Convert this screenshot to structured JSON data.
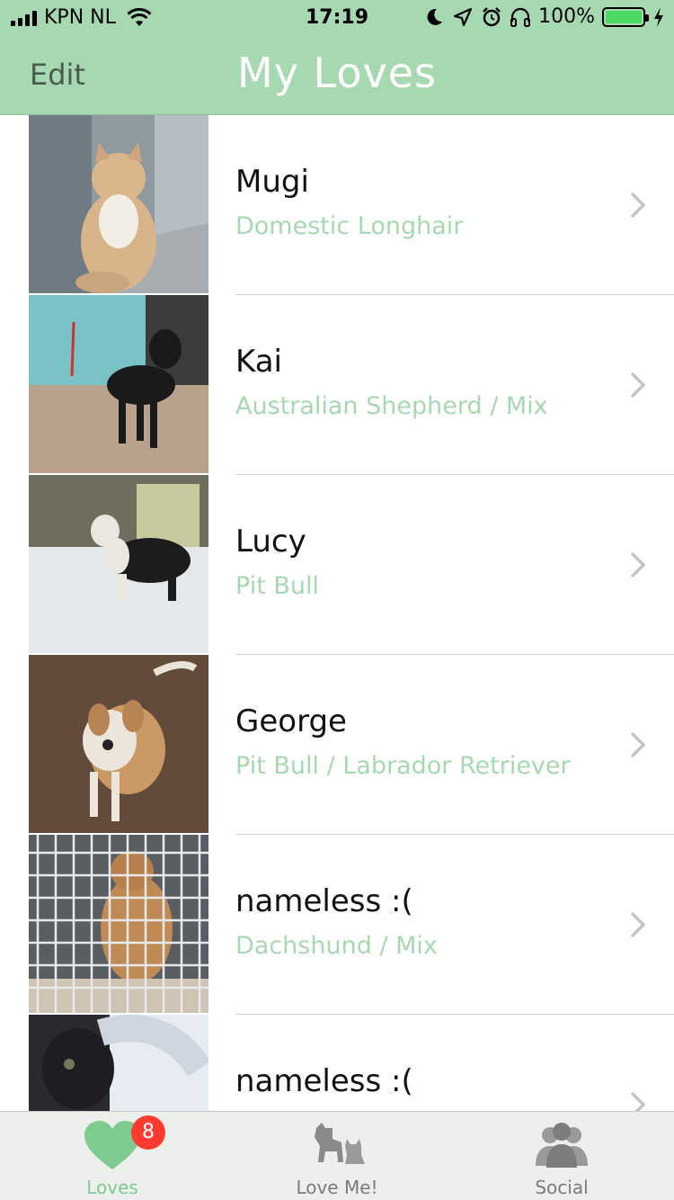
{
  "status_bar": {
    "carrier": "KPN NL",
    "time": "17:19",
    "battery_percent": "100%",
    "icons": [
      "signal-icon",
      "wifi-icon",
      "moon-icon",
      "location-icon",
      "alarm-icon",
      "headphones-icon",
      "battery-icon",
      "charging-icon"
    ]
  },
  "nav": {
    "edit_label": "Edit",
    "title": "My Loves"
  },
  "colors": {
    "brand_green": "#a6d9b1",
    "breed_text": "#a6d9b1",
    "badge_red": "#ff3b30",
    "active_tab": "#7ecb92"
  },
  "pets": [
    {
      "name": "Mugi",
      "breed": "Domestic Longhair",
      "photo": "cat-photo"
    },
    {
      "name": "Kai",
      "breed": "Australian Shepherd / Mix",
      "photo": "dog-photo"
    },
    {
      "name": "Lucy",
      "breed": "Pit Bull",
      "photo": "dog-photo"
    },
    {
      "name": "George",
      "breed": "Pit Bull / Labrador Retriever",
      "photo": "dog-photo"
    },
    {
      "name": "nameless :(",
      "breed": "Dachshund / Mix",
      "photo": "dog-in-kennel-photo"
    },
    {
      "name": "nameless :(",
      "breed": "",
      "photo": "cat-photo"
    }
  ],
  "tabs": [
    {
      "label": "Loves",
      "icon": "heart-icon",
      "badge": "8",
      "active": true
    },
    {
      "label": "Love Me!",
      "icon": "cat-dog-icon",
      "active": false
    },
    {
      "label": "Social",
      "icon": "people-icon",
      "active": false
    }
  ]
}
